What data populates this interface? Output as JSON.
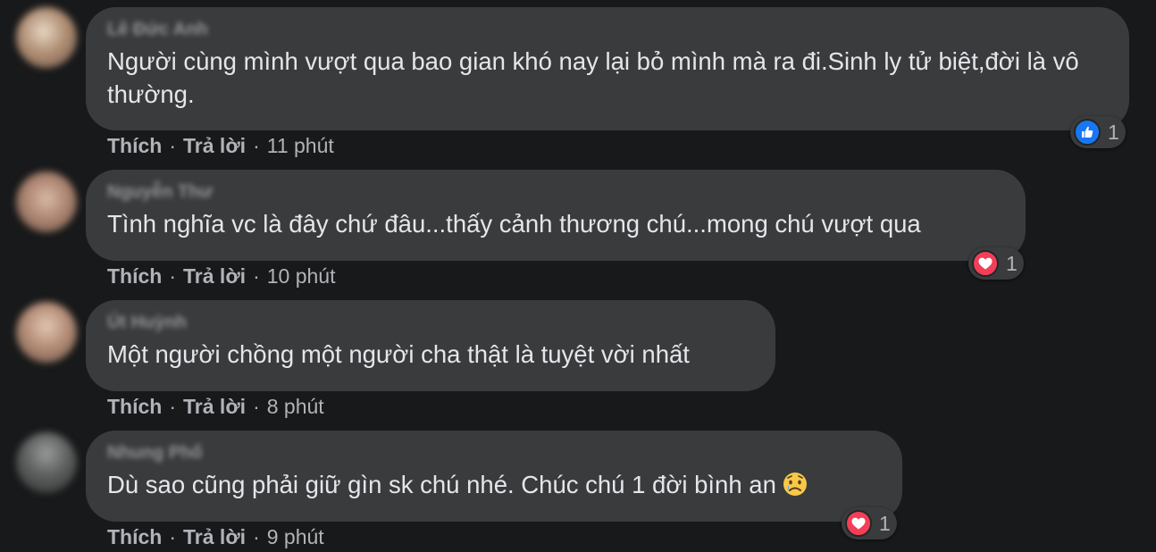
{
  "colors": {
    "background": "#18191a",
    "bubble": "#3a3b3c",
    "text": "#e4e6eb",
    "muted": "#b0b3b8",
    "like_blue": "#1877f2",
    "love_red": "#f33e58"
  },
  "comments": [
    {
      "author": "Lê Đức Anh",
      "text": "Người cùng mình vượt qua bao gian khó nay lại bỏ mình mà ra đi.Sinh ly tử biệt,đời là vô thường.",
      "like_label": "Thích",
      "reply_label": "Trả lời",
      "time": "11 phút",
      "reaction_icon": "like-icon",
      "reaction_count": "1"
    },
    {
      "author": "Nguyễn Thư",
      "text": "Tình nghĩa vc là đây chứ đâu...thấy cảnh thương chú...mong chú vượt qua",
      "like_label": "Thích",
      "reply_label": "Trả lời",
      "time": "10 phút",
      "reaction_icon": "love-icon",
      "reaction_count": "1"
    },
    {
      "author": "Út Huỳnh",
      "text": "Một người chồng một người cha thật là tuyệt vời nhất",
      "like_label": "Thích",
      "reply_label": "Trả lời",
      "time": "8 phút",
      "reaction_icon": "",
      "reaction_count": ""
    },
    {
      "author": "Nhung Phố",
      "text": "Dù sao cũng phải giữ gìn sk chú nhé. Chúc chú 1 đời bình an",
      "emoji": "sad-tear-emoji-icon",
      "like_label": "Thích",
      "reply_label": "Trả lời",
      "time": "9 phút",
      "reaction_icon": "love-icon",
      "reaction_count": "1"
    }
  ]
}
